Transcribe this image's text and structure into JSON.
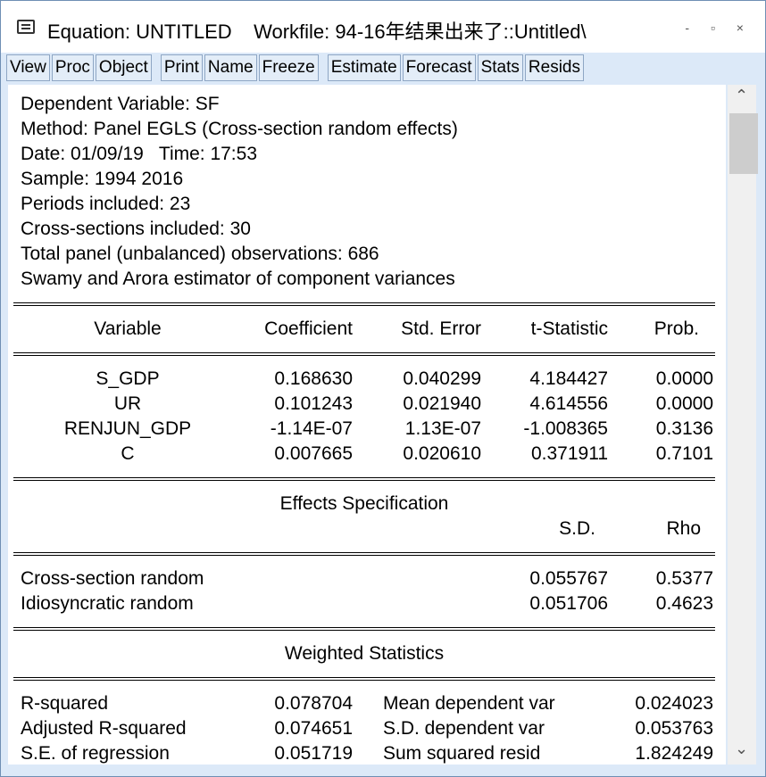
{
  "window": {
    "title": "Equation: UNTITLED    Workfile: 94-16年结果出来了::Untitled\\",
    "controls": "- ▫ ×"
  },
  "toolbar": {
    "group1": [
      "View",
      "Proc",
      "Object"
    ],
    "group2": [
      "Print",
      "Name",
      "Freeze"
    ],
    "group3": [
      "Estimate",
      "Forecast",
      "Stats",
      "Resids"
    ]
  },
  "header": {
    "dependent": "Dependent Variable: SF",
    "method": "Method: Panel EGLS (Cross-section random effects)",
    "datetime": "Date: 01/09/19   Time: 17:53",
    "sample": "Sample: 1994 2016",
    "periods": "Periods included: 23",
    "cross_sections": "Cross-sections included: 30",
    "observations": "Total panel (unbalanced) observations: 686",
    "estimator": "Swamy and Arora estimator of component variances"
  },
  "coef_table": {
    "headers": [
      "Variable",
      "Coefficient",
      "Std. Error",
      "t-Statistic",
      "Prob."
    ],
    "rows": [
      [
        "S_GDP",
        "0.168630",
        "0.040299",
        "4.184427",
        "0.0000"
      ],
      [
        "UR",
        "0.101243",
        "0.021940",
        "4.614556",
        "0.0000"
      ],
      [
        "RENJUN_GDP",
        "-1.14E-07",
        "1.13E-07",
        "-1.008365",
        "0.3136"
      ],
      [
        "C",
        "0.007665",
        "0.020610",
        "0.371911",
        "0.7101"
      ]
    ]
  },
  "effects": {
    "title": "Effects Specification",
    "col_sd": "S.D.",
    "col_rho": "Rho",
    "rows": [
      [
        "Cross-section random",
        "0.055767",
        "0.5377"
      ],
      [
        "Idiosyncratic random",
        "0.051706",
        "0.4623"
      ]
    ]
  },
  "weighted": {
    "title": "Weighted Statistics",
    "rows": [
      [
        "R-squared",
        "0.078704",
        "Mean dependent var",
        "0.024023"
      ],
      [
        "Adjusted R-squared",
        "0.074651",
        "S.D. dependent var",
        "0.053763"
      ],
      [
        "S.E. of regression",
        "0.051719",
        "Sum squared resid",
        "1.824249"
      ]
    ]
  }
}
